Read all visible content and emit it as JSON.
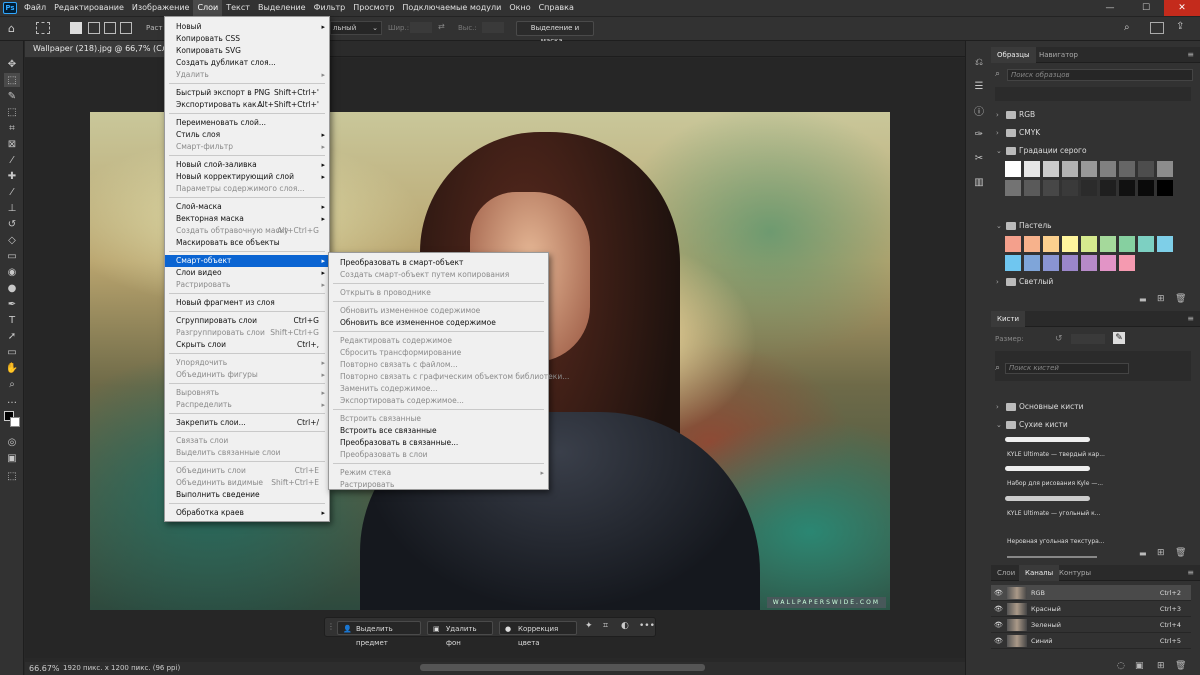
{
  "app": {
    "logo": "Ps"
  },
  "menubar": [
    "Файл",
    "Редактирование",
    "Изображение",
    "Слои",
    "Текст",
    "Выделение",
    "Фильтр",
    "Просмотр",
    "Подключаемые модули",
    "Окно",
    "Справка"
  ],
  "options": {
    "partial_left": "Раст",
    "partial_right": "льный",
    "width_label": "Шир.:",
    "height_label": "Выс.:",
    "select_mask": "Выделение и маска..."
  },
  "document": {
    "tab": "Wallpaper (218).jpg @ 66,7% (Слой 0, R"
  },
  "watermark": "WALLPAPERSWIDE.COM",
  "layer_menu": [
    {
      "label": "Новый",
      "arrow": true
    },
    {
      "label": "Копировать CSS"
    },
    {
      "label": "Копировать SVG"
    },
    {
      "label": "Создать дубликат слоя..."
    },
    {
      "label": "Удалить",
      "arrow": true,
      "disabled": true
    },
    {
      "sep": true
    },
    {
      "label": "Быстрый экспорт в PNG",
      "shortcut": "Shift+Ctrl+'"
    },
    {
      "label": "Экспортировать как...",
      "shortcut": "Alt+Shift+Ctrl+'"
    },
    {
      "sep": true
    },
    {
      "label": "Переименовать слой..."
    },
    {
      "label": "Стиль слоя",
      "arrow": true
    },
    {
      "label": "Смарт-фильтр",
      "arrow": true,
      "disabled": true
    },
    {
      "sep": true
    },
    {
      "label": "Новый слой-заливка",
      "arrow": true
    },
    {
      "label": "Новый корректирующий слой",
      "arrow": true
    },
    {
      "label": "Параметры содержимого слоя...",
      "disabled": true
    },
    {
      "sep": true
    },
    {
      "label": "Слой-маска",
      "arrow": true
    },
    {
      "label": "Векторная маска",
      "arrow": true
    },
    {
      "label": "Создать обтравочную маску",
      "shortcut": "Alt+Ctrl+G",
      "disabled": true
    },
    {
      "label": "Маскировать все объекты"
    },
    {
      "sep": true
    },
    {
      "label": "Смарт-объект",
      "arrow": true,
      "highlight": true
    },
    {
      "label": "Слои видео",
      "arrow": true
    },
    {
      "label": "Растрировать",
      "arrow": true,
      "disabled": true
    },
    {
      "sep": true
    },
    {
      "label": "Новый фрагмент из слоя"
    },
    {
      "sep": true
    },
    {
      "label": "Сгруппировать слои",
      "shortcut": "Ctrl+G"
    },
    {
      "label": "Разгруппировать слои",
      "shortcut": "Shift+Ctrl+G",
      "disabled": true
    },
    {
      "label": "Скрыть слои",
      "shortcut": "Ctrl+,"
    },
    {
      "sep": true
    },
    {
      "label": "Упорядочить",
      "arrow": true,
      "disabled": true
    },
    {
      "label": "Объединить фигуры",
      "arrow": true,
      "disabled": true
    },
    {
      "sep": true
    },
    {
      "label": "Выровнять",
      "arrow": true,
      "disabled": true
    },
    {
      "label": "Распределить",
      "arrow": true,
      "disabled": true
    },
    {
      "sep": true
    },
    {
      "label": "Закрепить слои...",
      "shortcut": "Ctrl+/"
    },
    {
      "sep": true
    },
    {
      "label": "Связать слои",
      "disabled": true
    },
    {
      "label": "Выделить связанные слои",
      "disabled": true
    },
    {
      "sep": true
    },
    {
      "label": "Объединить слои",
      "shortcut": "Ctrl+E",
      "disabled": true
    },
    {
      "label": "Объединить видимые",
      "shortcut": "Shift+Ctrl+E",
      "disabled": true
    },
    {
      "label": "Выполнить сведение"
    },
    {
      "sep": true
    },
    {
      "label": "Обработка краев",
      "arrow": true
    }
  ],
  "smart_menu": [
    {
      "label": "Преобразовать в смарт-объект"
    },
    {
      "label": "Создать смарт-объект путем копирования",
      "disabled": true
    },
    {
      "sep": true
    },
    {
      "label": "Открыть в проводнике",
      "disabled": true
    },
    {
      "sep": true
    },
    {
      "label": "Обновить измененное содержимое",
      "disabled": true
    },
    {
      "label": "Обновить все измененное содержимое"
    },
    {
      "sep": true
    },
    {
      "label": "Редактировать содержимое",
      "disabled": true
    },
    {
      "label": "Сбросить трансформирование",
      "disabled": true
    },
    {
      "label": "Повторно связать с файлом...",
      "disabled": true
    },
    {
      "label": "Повторно связать с графическим объектом библиотеки...",
      "disabled": true
    },
    {
      "label": "Заменить содержимое...",
      "disabled": true
    },
    {
      "label": "Экспортировать содержимое...",
      "disabled": true
    },
    {
      "sep": true
    },
    {
      "label": "Встроить связанные",
      "disabled": true
    },
    {
      "label": "Встроить все связанные"
    },
    {
      "label": "Преобразовать в связанные..."
    },
    {
      "label": "Преобразовать в слои",
      "disabled": true
    },
    {
      "sep": true
    },
    {
      "label": "Режим стека",
      "arrow": true,
      "disabled": true
    },
    {
      "label": "Растрировать",
      "disabled": true
    }
  ],
  "swatches": {
    "tabs": [
      "Образцы",
      "Навигатор"
    ],
    "search": "Поиск образцов",
    "groups": [
      "RGB",
      "CMYK",
      "Градации серого",
      "Пастель",
      "Светлый"
    ],
    "gray": [
      "#ffffff",
      "#e6e6e6",
      "#cccccc",
      "#b3b3b3",
      "#999999",
      "#808080",
      "#666666",
      "#4d4d4d",
      "#8c8c8c",
      "#737373",
      "#5a5a5a",
      "#474747",
      "#3a3a3a",
      "#2b2b2b",
      "#1f1f1f",
      "#111111",
      "#0a0a0a",
      "#000000"
    ],
    "pastel": [
      "#f4a08c",
      "#f7b28c",
      "#fbd08e",
      "#fff59d",
      "#d6ea8e",
      "#a5d99b",
      "#86d0a0",
      "#7dd0c2",
      "#7ecfe8",
      "#6fc6f0",
      "#7fa5d9",
      "#8a94d2",
      "#9b86c9",
      "#b68ac8",
      "#e294c6",
      "#f59ab0"
    ]
  },
  "brushes": {
    "tab": "Кисти",
    "size_label": "Размер:",
    "search": "Поиск кистей",
    "groups": [
      "Основные кисти",
      "Сухие кисти"
    ],
    "items": [
      "KYLE Ultimate — твердый кар...",
      "Набор для рисования Kyle —...",
      "KYLE Ultimate — угольный к...",
      "Неровная угольная текстура..."
    ]
  },
  "channels": {
    "tabs": [
      "Слои",
      "Каналы",
      "Контуры"
    ],
    "rows": [
      {
        "name": "RGB",
        "shortcut": "Ctrl+2"
      },
      {
        "name": "Красный",
        "shortcut": "Ctrl+3"
      },
      {
        "name": "Зеленый",
        "shortcut": "Ctrl+4"
      },
      {
        "name": "Синий",
        "shortcut": "Ctrl+5"
      }
    ]
  },
  "contextbar": {
    "select_subject": "Выделить предмет",
    "remove_bg": "Удалить фон",
    "color_fix": "Коррекция цвета"
  },
  "status": {
    "zoom": "66.67%",
    "info": "1920 пикс. x 1200 пикс. (96 ppi)"
  }
}
